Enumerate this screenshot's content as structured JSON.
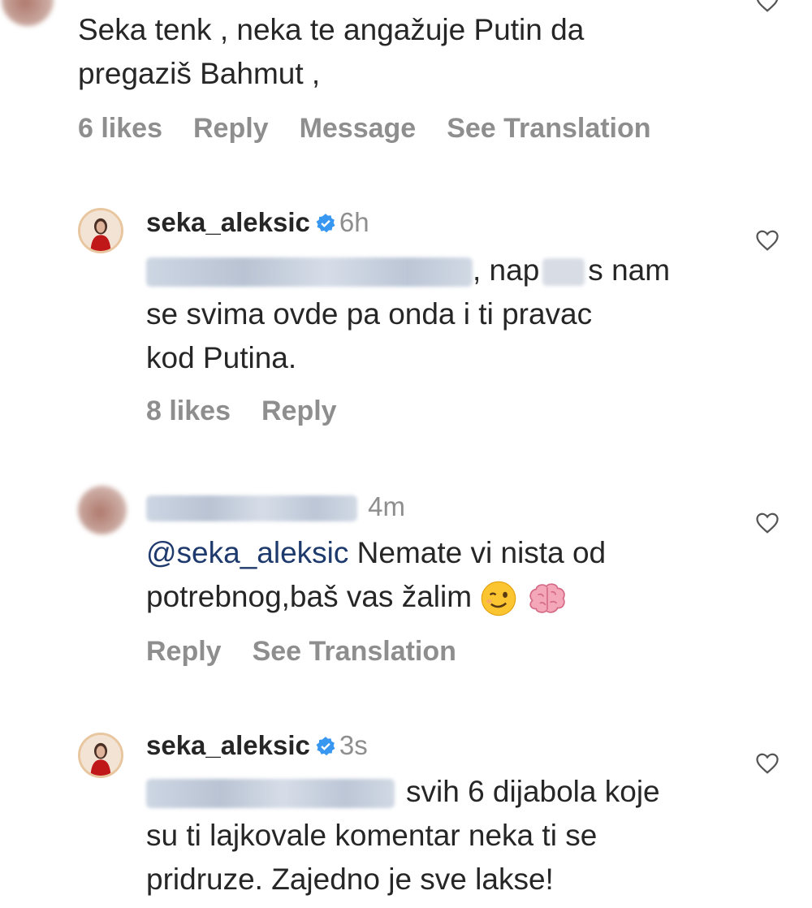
{
  "comments": [
    {
      "body": "Seka tenk , neka te angažuje Putin da pregaziš Bahmut ,",
      "actions": {
        "likes": "6 likes",
        "reply": "Reply",
        "message": "Message",
        "translate": "See Translation"
      }
    },
    {
      "username": "seka_aleksic",
      "time": "6h",
      "body_part1": ", nap",
      "body_part2": "s nam",
      "body_line2": "se svima ovde pa onda i ti pravac",
      "body_line3": "kod Putina.",
      "actions": {
        "likes": "8 likes",
        "reply": "Reply"
      }
    },
    {
      "time": "4m",
      "mention": "@seka_aleksic",
      "body_line1": " Nemate vi nista od",
      "body_line2": "potrebnog,baš vas žalim",
      "emojis": [
        "winking-face",
        "brain"
      ],
      "actions": {
        "reply": "Reply",
        "translate": "See Translation"
      }
    },
    {
      "username": "seka_aleksic",
      "time": "3s",
      "body_line1": "svih 6 dijabola koje",
      "body_line2": "su ti lajkovale komentar neka ti se",
      "body_line3": "pridruze. Zajedno je sve lakse!"
    }
  ],
  "colors": {
    "text": "#262626",
    "muted": "#8e8e8e",
    "verified": "#3897f0",
    "mention": "#1e3a6d"
  }
}
